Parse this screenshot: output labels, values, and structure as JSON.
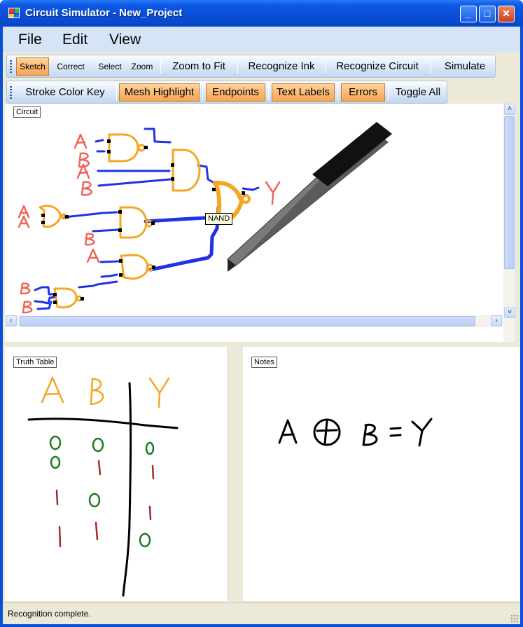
{
  "window": {
    "title": "Circuit Simulator - New_Project"
  },
  "titlebar_buttons": {
    "minimize": "_",
    "maximize": "□",
    "close": "✕"
  },
  "menu": [
    "File",
    "Edit",
    "View"
  ],
  "toolbar": {
    "modes": [
      {
        "label": "Sketch",
        "checked": true
      },
      {
        "label": "Correct",
        "checked": false
      },
      {
        "label": "Select",
        "checked": false
      },
      {
        "label": "Zoom",
        "checked": false
      }
    ],
    "zoom_to_fit": "Zoom to Fit",
    "recognize_ink": "Recognize Ink",
    "recognize_circuit": "Recognize Circuit",
    "simulate": "Simulate"
  },
  "display_toolbar": {
    "stroke_color_key": "Stroke Color Key",
    "mesh_highlight": "Mesh Highlight",
    "endpoints": "Endpoints",
    "text_labels": "Text Labels",
    "errors": "Errors",
    "toggle_all": "Toggle All"
  },
  "panels": {
    "circuit": {
      "label": "Circuit"
    },
    "truth_table": {
      "label": "Truth Table"
    },
    "notes": {
      "label": "Notes"
    }
  },
  "tooltip": "NAND",
  "status": "Recognition complete.",
  "colors": {
    "label_ink": "#f0645a",
    "gate_ink": "#f5a623",
    "wire_ink": "#1f33e6",
    "endpoint": "#000000",
    "ones_ink": "#a52a2a",
    "zeros_ink": "#1e7a1e"
  }
}
